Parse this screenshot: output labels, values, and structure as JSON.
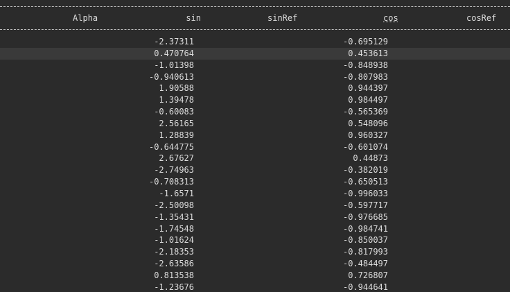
{
  "header": {
    "alpha": "Alpha",
    "sin": "sin",
    "sinRef": "sinRef",
    "cos": "cos",
    "cosRef": "cosRef"
  },
  "rows": [
    {
      "sin": "-2.37311",
      "cos": "-0.695129"
    },
    {
      "sin": "0.470764",
      "cos": "0.453613"
    },
    {
      "sin": "-1.01398",
      "cos": "-0.848938"
    },
    {
      "sin": "-0.940613",
      "cos": "-0.807983"
    },
    {
      "sin": "1.90588",
      "cos": "0.944397"
    },
    {
      "sin": "1.39478",
      "cos": "0.984497"
    },
    {
      "sin": "-0.60083",
      "cos": "-0.565369"
    },
    {
      "sin": "2.56165",
      "cos": "0.548096"
    },
    {
      "sin": "1.28839",
      "cos": "0.960327"
    },
    {
      "sin": "-0.644775",
      "cos": "-0.601074"
    },
    {
      "sin": "2.67627",
      "cos": "0.44873"
    },
    {
      "sin": "-2.74963",
      "cos": "-0.382019"
    },
    {
      "sin": "-0.708313",
      "cos": "-0.650513"
    },
    {
      "sin": "-1.6571",
      "cos": "-0.996033"
    },
    {
      "sin": "-2.50098",
      "cos": "-0.597717"
    },
    {
      "sin": "-1.35431",
      "cos": "-0.976685"
    },
    {
      "sin": "-1.74548",
      "cos": "-0.984741"
    },
    {
      "sin": "-1.01624",
      "cos": "-0.850037"
    },
    {
      "sin": "-2.18353",
      "cos": "-0.817993"
    },
    {
      "sin": "-2.63586",
      "cos": "-0.484497"
    },
    {
      "sin": "0.813538",
      "cos": "0.726807"
    },
    {
      "sin": "-1.23676",
      "cos": "-0.944641"
    }
  ]
}
